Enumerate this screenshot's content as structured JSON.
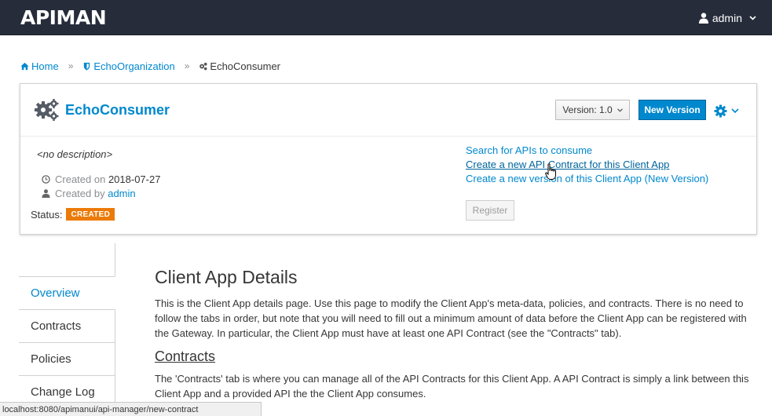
{
  "header": {
    "logo": "APIMAN",
    "user": "admin"
  },
  "breadcrumb": {
    "home": "Home",
    "organization": "EchoOrganization",
    "current": "EchoConsumer",
    "separator": "»"
  },
  "card": {
    "title": "EchoConsumer",
    "version_label": "Version: 1.0",
    "new_version_label": "New Version",
    "description": "<no description>",
    "created_on_label": "Created on",
    "created_on_value": "2018-07-27",
    "created_by_label": "Created by",
    "created_by_value": "admin",
    "status_label": "Status:",
    "status_value": "CREATED",
    "actions": [
      "Search for APIs to consume",
      "Create a new API Contract for this Client App",
      "Create a new version of this Client App (New Version)"
    ],
    "register_label": "Register"
  },
  "tabs": [
    {
      "label": "Overview"
    },
    {
      "label": "Contracts"
    },
    {
      "label": "Policies"
    },
    {
      "label": "Change Log"
    }
  ],
  "main": {
    "title": "Client App Details",
    "intro": "This is the Client App details page. Use this page to modify the Client App's meta-data, policies, and contracts. There is no need to follow the tabs in order, but note that you will need to fill out a minimum amount of data before the Client App can be registered with the Gateway. In particular, the Client App must have at least one API Contract (see the \"Contracts\" tab).",
    "contracts_heading": "Contracts",
    "contracts_text": "The 'Contracts' tab is where you can manage all of the API Contracts for this Client App. A API Contract is simply a link between this Client App and a provided API the the Client App consumes."
  },
  "statusbar": {
    "url": "localhost:8080/apimanui/api-manager/new-contract"
  },
  "colors": {
    "navbar": "#262c3a",
    "link": "#0088ce",
    "badge": "#ec7a08"
  }
}
